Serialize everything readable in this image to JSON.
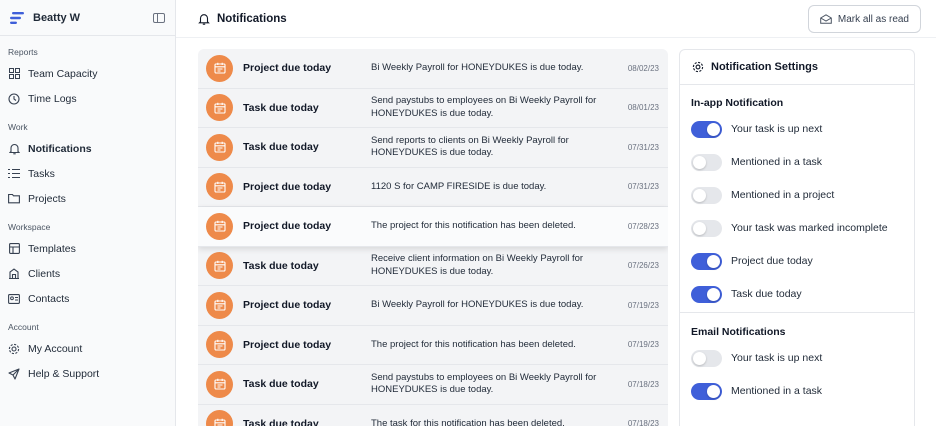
{
  "sidebar": {
    "user_name": "Beatty W",
    "sections": {
      "reports": "Reports",
      "work": "Work",
      "workspace": "Workspace",
      "account": "Account"
    },
    "items": [
      {
        "label": "Team Capacity"
      },
      {
        "label": "Time Logs"
      },
      {
        "label": "Notifications"
      },
      {
        "label": "Tasks"
      },
      {
        "label": "Projects"
      },
      {
        "label": "Templates"
      },
      {
        "label": "Clients"
      },
      {
        "label": "Contacts"
      },
      {
        "label": "My Account"
      },
      {
        "label": "Help & Support"
      }
    ]
  },
  "header": {
    "title": "Notifications",
    "mark_all_label": "Mark all as read"
  },
  "notifications": [
    {
      "type": "Project due today",
      "message": "Bi Weekly Payroll for HONEYDUKES is due today.",
      "date": "08/02/23"
    },
    {
      "type": "Task due today",
      "message": "Send paystubs to employees on Bi Weekly Payroll for HONEYDUKES is due today.",
      "date": "08/01/23"
    },
    {
      "type": "Task due today",
      "message": "Send reports to clients on Bi Weekly Payroll for HONEYDUKES is due today.",
      "date": "07/31/23"
    },
    {
      "type": "Project due today",
      "message": "1120 S for CAMP FIRESIDE is due today.",
      "date": "07/31/23"
    },
    {
      "type": "Project due today",
      "message": "The project for this notification has been deleted.",
      "date": "07/28/23"
    },
    {
      "type": "Task due today",
      "message": "Receive client information on Bi Weekly Payroll for HONEYDUKES is due today.",
      "date": "07/26/23"
    },
    {
      "type": "Project due today",
      "message": "Bi Weekly Payroll for HONEYDUKES is due today.",
      "date": "07/19/23"
    },
    {
      "type": "Project due today",
      "message": "The project for this notification has been deleted.",
      "date": "07/19/23"
    },
    {
      "type": "Task due today",
      "message": "Send paystubs to employees on Bi Weekly Payroll for HONEYDUKES is due today.",
      "date": "07/18/23"
    },
    {
      "type": "Task due today",
      "message": "The task for this notification has been deleted.",
      "date": "07/18/23"
    }
  ],
  "settings": {
    "title": "Notification Settings",
    "in_app": {
      "title": "In-app Notification",
      "options": [
        {
          "label": "Your task is up next",
          "enabled": true
        },
        {
          "label": "Mentioned in a task",
          "enabled": false
        },
        {
          "label": "Mentioned in a project",
          "enabled": false
        },
        {
          "label": "Your task was marked incomplete",
          "enabled": false
        },
        {
          "label": "Project due today",
          "enabled": true
        },
        {
          "label": "Task due today",
          "enabled": true
        }
      ]
    },
    "email": {
      "title": "Email Notifications",
      "options": [
        {
          "label": "Your task is up next",
          "enabled": false
        },
        {
          "label": "Mentioned in a task",
          "enabled": true
        }
      ]
    }
  },
  "colors": {
    "accent": "#3f5fd9",
    "notification_icon": "#ee8a4a"
  }
}
